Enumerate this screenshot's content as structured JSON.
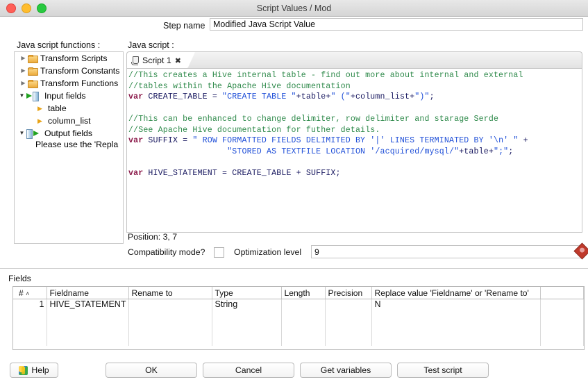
{
  "window": {
    "title": "Script Values / Mod",
    "traffic_lights": [
      "close-button",
      "minimize-button",
      "maximize-button"
    ]
  },
  "step": {
    "label": "Step name",
    "value": "Modified Java Script Value"
  },
  "left_panel": {
    "heading": "Java script functions :",
    "tree": [
      {
        "label": "Transform Scripts",
        "icon": "folder-icon",
        "state": "collapsed",
        "indent": 0
      },
      {
        "label": "Transform Constants",
        "icon": "folder-icon",
        "state": "collapsed",
        "indent": 0
      },
      {
        "label": "Transform Functions",
        "icon": "folder-icon",
        "state": "collapsed",
        "indent": 0
      },
      {
        "label": "Input fields",
        "icon": "input-fields-icon",
        "state": "expanded",
        "indent": 0
      },
      {
        "label": "table",
        "icon": "none",
        "state": "leaf",
        "indent": 1
      },
      {
        "label": "column_list",
        "icon": "none",
        "state": "leaf",
        "indent": 1
      },
      {
        "label": "Output fields",
        "icon": "output-fields-icon",
        "state": "expanded",
        "indent": 0
      }
    ],
    "note": "Please use the 'Repla"
  },
  "script_panel": {
    "heading": "Java script :",
    "tab": {
      "label": "Script 1",
      "icon": "script-icon",
      "close": "✖"
    },
    "code_lines": [
      {
        "tokens": [
          {
            "t": "//This creates a Hive internal table - find out more about internal and external",
            "c": "cm"
          }
        ]
      },
      {
        "tokens": [
          {
            "t": "//tables within the Apache Hive documentation",
            "c": "cm"
          }
        ]
      },
      {
        "tokens": [
          {
            "t": "var",
            "c": "kw"
          },
          {
            "t": " CREATE_TABLE = ",
            "c": "id"
          },
          {
            "t": "\"CREATE TABLE \"",
            "c": "st"
          },
          {
            "t": "+table+",
            "c": "id"
          },
          {
            "t": "\" (\"",
            "c": "st"
          },
          {
            "t": "+column_list+",
            "c": "id"
          },
          {
            "t": "\")\"",
            "c": "st"
          },
          {
            "t": ";",
            "c": "id"
          }
        ]
      },
      {
        "tokens": []
      },
      {
        "tokens": [
          {
            "t": "//This can be enhanced to change delimiter, row delimiter and starage Serde",
            "c": "cm"
          }
        ]
      },
      {
        "tokens": [
          {
            "t": "//See Apache Hive documentation for futher details.",
            "c": "cm"
          }
        ]
      },
      {
        "tokens": [
          {
            "t": "var",
            "c": "kw"
          },
          {
            "t": " SUFFIX = ",
            "c": "id"
          },
          {
            "t": "\" ROW FORMATTED FIELDS DELIMITED BY '|' LINES TERMINATED BY '\\n' \"",
            "c": "st"
          },
          {
            "t": " +",
            "c": "id"
          }
        ]
      },
      {
        "tokens": [
          {
            "t": "                    ",
            "c": "id"
          },
          {
            "t": "\"STORED AS TEXTFILE LOCATION '/acquired/mysql/\"",
            "c": "st"
          },
          {
            "t": "+table+",
            "c": "id"
          },
          {
            "t": "\";\"",
            "c": "st"
          },
          {
            "t": ";",
            "c": "id"
          }
        ]
      },
      {
        "tokens": []
      },
      {
        "tokens": [
          {
            "t": "var",
            "c": "kw"
          },
          {
            "t": " HIVE_STATEMENT = CREATE_TABLE + SUFFIX;",
            "c": "id"
          }
        ]
      }
    ],
    "position": "Position: 3, 7",
    "compatibility_label": "Compatibility mode?",
    "compatibility_checked": false,
    "optimization_label": "Optimization level",
    "optimization_value": "9",
    "error_marker": "diamond-marker-icon"
  },
  "fields": {
    "label": "Fields",
    "columns": [
      "#",
      "Fieldname",
      "Rename to",
      "Type",
      "Length",
      "Precision",
      "Replace value 'Fieldname' or 'Rename to'",
      ""
    ],
    "sort_indicator": "˄",
    "rows": [
      {
        "num": "1",
        "fieldname": "HIVE_STATEMENT",
        "rename_to": "",
        "type": "String",
        "length": "",
        "precision": "",
        "replace_value": "N",
        "extra": ""
      }
    ]
  },
  "buttons": {
    "help": "Help",
    "ok": "OK",
    "cancel": "Cancel",
    "get_variables": "Get variables",
    "test_script": "Test script"
  },
  "colors": {
    "comment": "#2f8a4b",
    "keyword": "#8b1a4a",
    "identifier": "#16165e",
    "string": "#1f4fd8",
    "folder": "#ecab3c",
    "error_marker": "#c0392b"
  }
}
